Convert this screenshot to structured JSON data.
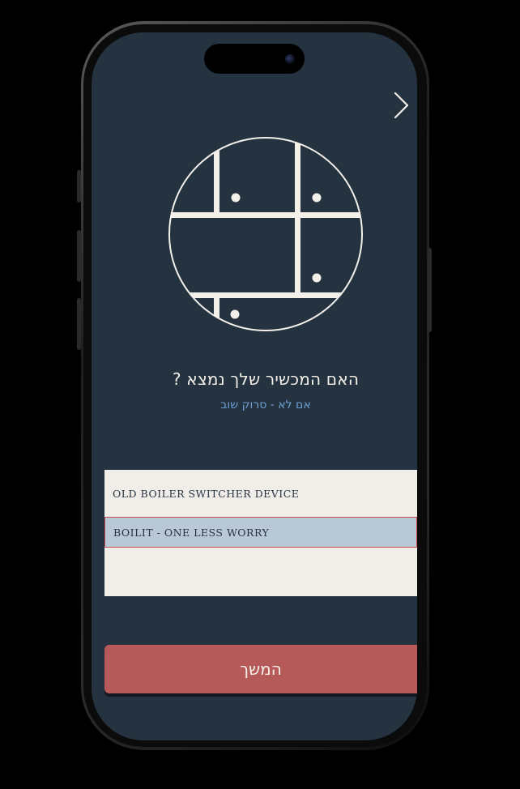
{
  "screen": {
    "question": "האם המכשיר שלך נמצא ?",
    "subtitle": "אם לא - סרוק שוב"
  },
  "devices": [
    {
      "label": "OLD BOILER SWITCHER DEVICE",
      "selected": false
    },
    {
      "label": "BOILIT - ONE LESS WORRY",
      "selected": true
    }
  ],
  "continue_label": "המשך",
  "icons": {
    "back": "chevron-right-icon",
    "illustration": "wall-switch-illustration-icon"
  },
  "colors": {
    "background": "#253341",
    "accent": "#b55a58",
    "subtitle": "#6d9ed1",
    "list_background": "#f1eeea",
    "selected_item": "#b8c8d6",
    "selected_border": "#c84f50"
  }
}
